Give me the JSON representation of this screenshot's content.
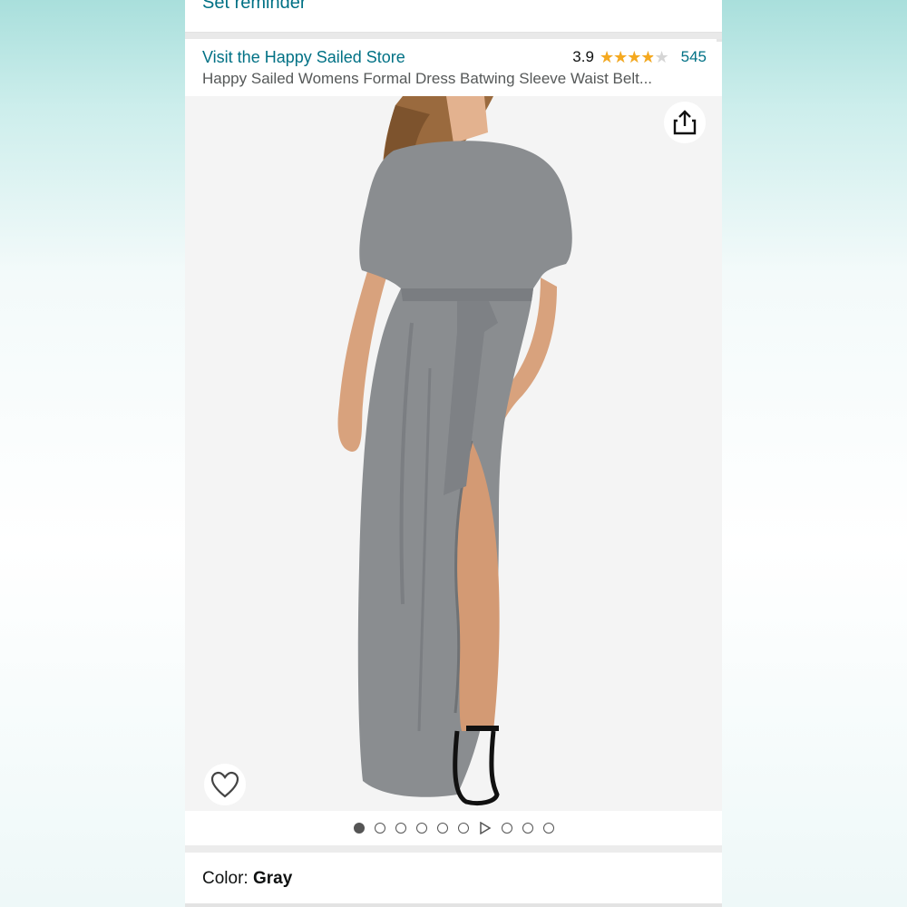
{
  "reminder": {
    "label": "Set reminder"
  },
  "product": {
    "store_link": "Visit the Happy Sailed Store",
    "rating": "3.9",
    "rating_fraction": 0.78,
    "review_count": "545",
    "title": "Happy Sailed Womens Formal Dress Batwing Sleeve Waist Belt..."
  },
  "gallery": {
    "total_items": 10,
    "active_index": 0,
    "video_index": 6
  },
  "color": {
    "label": "Color: ",
    "value": "Gray"
  },
  "colors": {
    "link": "#007185",
    "star": "#f5a91f",
    "dress": "#8a8d90"
  },
  "icons": {
    "share": "share-icon",
    "wishlist": "heart-icon",
    "video": "play-icon"
  }
}
